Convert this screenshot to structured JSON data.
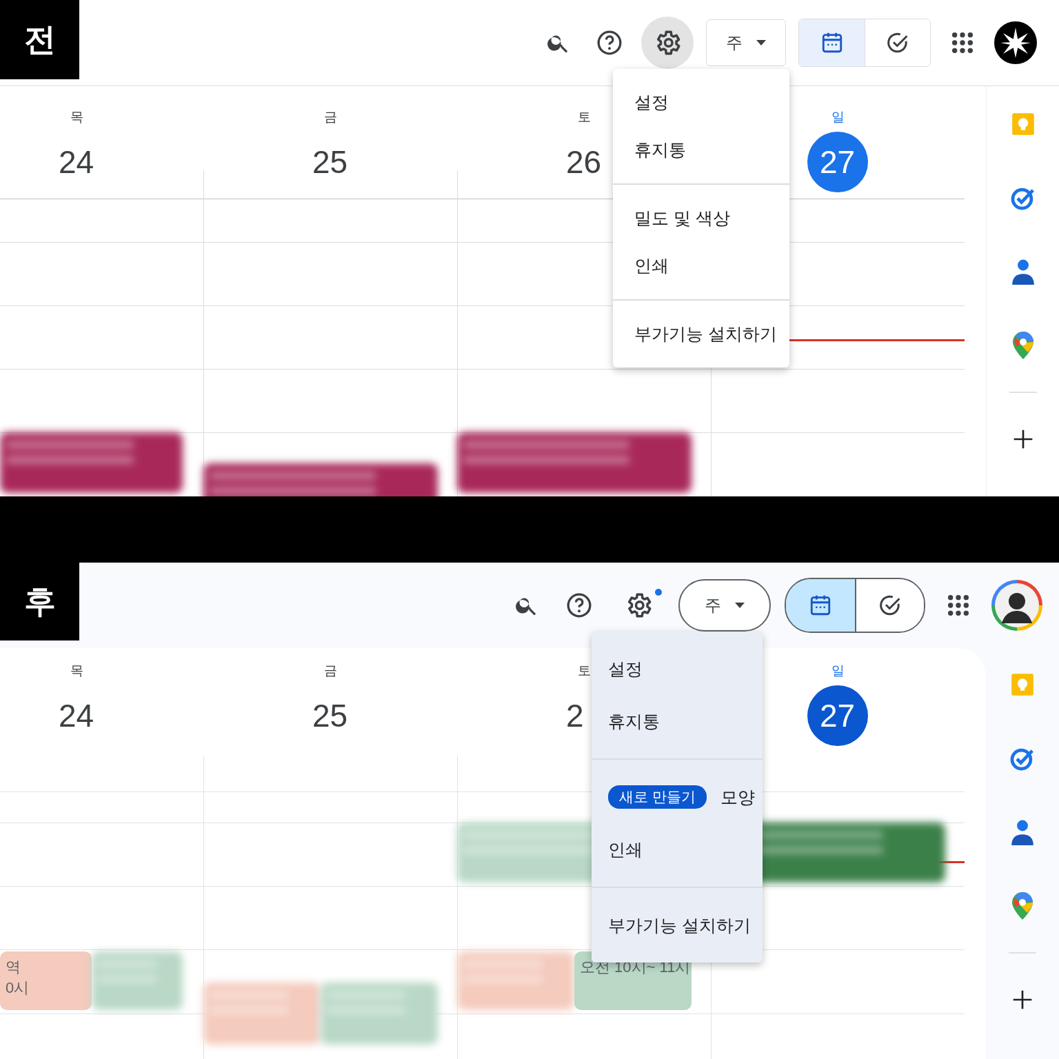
{
  "panels": [
    {
      "label": "전",
      "kind": "classic",
      "toolbar": {
        "settings_active": true,
        "settings_dot": false,
        "view": "주",
        "modes": [
          {
            "kind": "calendar",
            "selected": true
          },
          {
            "kind": "tasks",
            "selected": false
          }
        ],
        "avatar": {
          "kind": "logo"
        }
      },
      "days": [
        {
          "weekday": "목",
          "date": "24",
          "today": false,
          "upper": [
            {
              "color": "#a8285a",
              "blurred": true
            }
          ]
        },
        {
          "weekday": "금",
          "date": "25",
          "today": false,
          "lowest": [
            {
              "color": "#a8285a",
              "blurred": true
            }
          ]
        },
        {
          "weekday": "토",
          "date": "26",
          "today": false,
          "upper": [
            {
              "color": "#a8285a",
              "blurred": true
            }
          ]
        },
        {
          "weekday": "일",
          "date": "27",
          "today": true
        }
      ],
      "menu": {
        "sections": [
          [
            {
              "label": "설정"
            },
            {
              "label": "휴지통"
            }
          ],
          [
            {
              "label": "밀도 및 색상"
            },
            {
              "label": "인쇄"
            }
          ],
          [
            {
              "label": "부가기능 설치하기"
            }
          ]
        ]
      }
    },
    {
      "label": "후",
      "kind": "material",
      "toolbar": {
        "settings_active": false,
        "settings_dot": true,
        "view": "주",
        "modes": [
          {
            "kind": "calendar",
            "selected": true
          },
          {
            "kind": "tasks",
            "selected": false
          }
        ],
        "avatar": {
          "kind": "photo"
        }
      },
      "days": [
        {
          "weekday": "목",
          "date": "24",
          "today": false,
          "lower": [
            {
              "color": "#f4cbbd",
              "blurred": false,
              "title": "역",
              "time": "0시"
            },
            {
              "color": "#b9d8c6",
              "blurred": true
            }
          ]
        },
        {
          "weekday": "금",
          "date": "25",
          "today": false,
          "lowest": [
            {
              "color": "#f4cbbd",
              "blurred": true
            },
            {
              "color": "#b9d8c6",
              "blurred": true
            }
          ]
        },
        {
          "weekday": "토",
          "date": "2",
          "today": false,
          "upper": [
            {
              "color": "#b9d8c6",
              "blurred": true
            }
          ],
          "lower": [
            {
              "color": "#f4cbbd",
              "blurred": true
            },
            {
              "color": "#b9d8c6",
              "blurred": false,
              "time": "오전 10시~ 11시"
            }
          ]
        },
        {
          "weekday": "일",
          "date": "27",
          "today": true,
          "upper": [
            {
              "color": "#3b8049",
              "blurred": true
            }
          ]
        }
      ],
      "menu": {
        "sections": [
          [
            {
              "label": "설정"
            },
            {
              "label": "휴지통"
            }
          ],
          [
            {
              "badge": "새로 만들기",
              "label": "모양"
            },
            {
              "label": "인쇄"
            }
          ],
          [
            {
              "label": "부가기능 설치하기"
            }
          ]
        ]
      }
    }
  ]
}
